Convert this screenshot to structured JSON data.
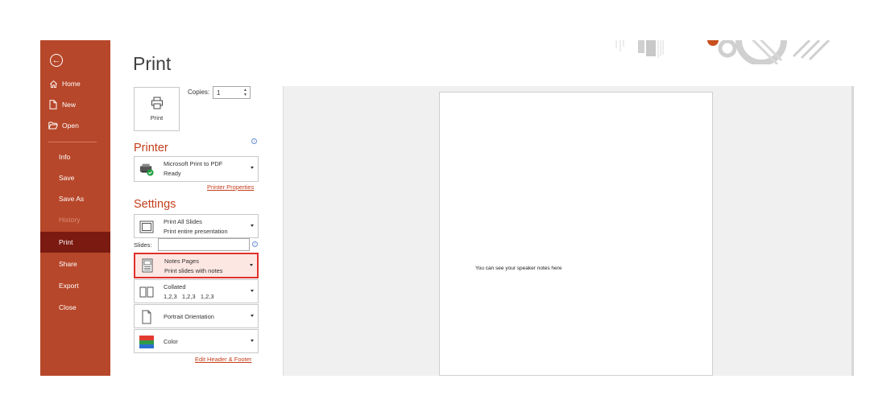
{
  "sidebar": {
    "back_icon": "back-arrow-icon",
    "items": [
      {
        "label": "Home",
        "icon": "home-icon"
      },
      {
        "label": "New",
        "icon": "new-document-icon"
      },
      {
        "label": "Open",
        "icon": "folder-open-icon"
      },
      {
        "label": "Info"
      },
      {
        "label": "Save"
      },
      {
        "label": "Save As"
      },
      {
        "label": "History",
        "disabled": true
      },
      {
        "label": "Print",
        "active": true
      },
      {
        "label": "Share"
      },
      {
        "label": "Export"
      },
      {
        "label": "Close"
      }
    ]
  },
  "print": {
    "title": "Print",
    "button_label": "Print",
    "copies_label": "Copies:",
    "copies_value": "1"
  },
  "printer": {
    "heading": "Printer",
    "name": "Microsoft Print to PDF",
    "status": "Ready",
    "properties_link": "Printer Properties"
  },
  "settings": {
    "heading": "Settings",
    "slides_label": "Slides:",
    "slides_value": "",
    "range": {
      "title": "Print All Slides",
      "subtitle": "Print entire presentation"
    },
    "layout": {
      "title": "Notes Pages",
      "subtitle": "Print slides with notes"
    },
    "collation": {
      "title": "Collated",
      "subtitle": "1,2,3   1,2,3   1,2,3"
    },
    "orientation": {
      "title": "Portrait Orientation"
    },
    "color": {
      "title": "Color"
    },
    "header_footer_link": "Edit Header & Footer"
  },
  "preview": {
    "notes_text": "You can see your speaker notes here"
  },
  "colors": {
    "sidebar_bg": "#b7472a",
    "sidebar_active": "#7b1a10",
    "accent": "#c43e1c",
    "highlight_border": "#e0302a"
  }
}
